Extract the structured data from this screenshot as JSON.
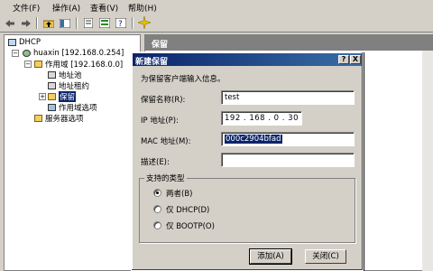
{
  "menu": [
    {
      "label": "文件(F)"
    },
    {
      "label": "操作(A)"
    },
    {
      "label": "查看(V)"
    },
    {
      "label": "帮助(H)"
    }
  ],
  "toolbar": {
    "icons": [
      "back-arrow-icon",
      "forward-arrow-icon",
      "up-folder-icon",
      "console-tree-icon",
      "properties-icon",
      "export-list-icon",
      "help-icon",
      "new-star-icon"
    ]
  },
  "tree": {
    "items": [
      {
        "label": "DHCP",
        "icon": "dhcp-root-icon"
      },
      {
        "label": "huaxin [192.168.0.254]",
        "icon": "server-icon"
      },
      {
        "label": "作用域 [192.168.0.0]",
        "icon": "scope-folder-icon"
      },
      {
        "label": "地址池",
        "icon": "address-pool-icon"
      },
      {
        "label": "地址租约",
        "icon": "address-lease-icon"
      },
      {
        "label": "保留",
        "icon": "reservations-folder-icon"
      },
      {
        "label": "作用域选项",
        "icon": "scope-options-icon"
      },
      {
        "label": "服务器选项",
        "icon": "server-options-icon"
      }
    ]
  },
  "right_pane": {
    "header": "保留"
  },
  "dialog": {
    "title": "新建保留",
    "help_btn": "?",
    "close_btn": "X",
    "intro": "为保留客户端输入信息。",
    "fields": {
      "name_label": "保留名称(R):",
      "name_value": "test",
      "ip_label": "IP 地址(P):",
      "ip_value": "192 . 168 . 0 . 30",
      "mac_label": "MAC 地址(M):",
      "mac_value": "000c2904bfad",
      "desc_label": "描述(E):",
      "desc_value": ""
    },
    "group": {
      "title": "支持的类型",
      "options": [
        {
          "label": "两者(B)",
          "selected": true
        },
        {
          "label": "仅 DHCP(D)",
          "selected": false
        },
        {
          "label": "仅 BOOTP(O)",
          "selected": false
        }
      ]
    },
    "buttons": {
      "add": "添加(A)",
      "close": "关闭(C)"
    }
  }
}
